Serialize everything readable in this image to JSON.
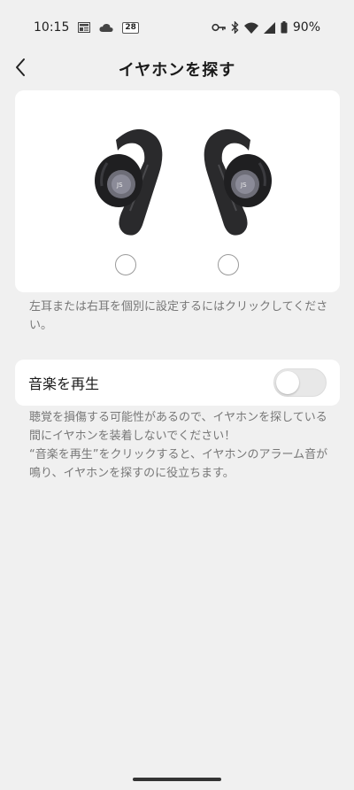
{
  "status_bar": {
    "time": "10:15",
    "notification_badge": "28",
    "battery": "90%"
  },
  "header": {
    "title": "イヤホンを探す"
  },
  "earbud_card": {
    "hint": "左耳または右耳を個別に設定するにはクリックしてください。"
  },
  "play_music": {
    "label": "音楽を再生",
    "enabled": false
  },
  "warning": {
    "line1": "聴覚を損傷する可能性があるので、イヤホンを探している間にイヤホンを装着しないでください！",
    "line2": "“音楽を再生”をクリックすると、イヤホンのアラーム音が鳴り、イヤホンを探すのに役立ちます。"
  },
  "colors": {
    "background": "#f0f0f0",
    "card": "#ffffff",
    "muted_text": "#777777"
  }
}
